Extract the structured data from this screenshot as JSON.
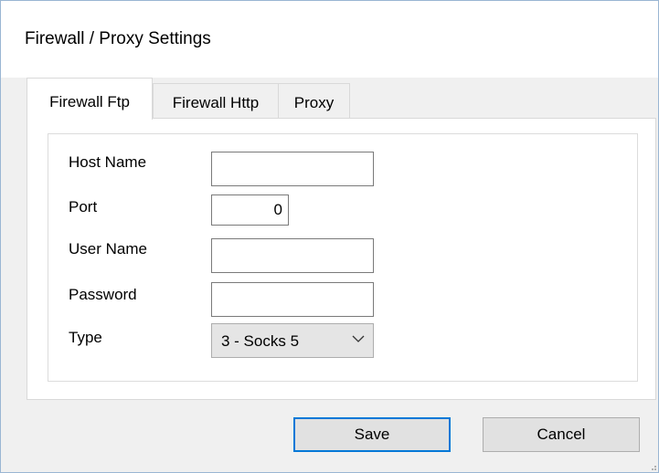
{
  "window": {
    "title": "Firewall / Proxy Settings"
  },
  "tabs": [
    {
      "label": "Firewall Ftp",
      "active": true
    },
    {
      "label": "Firewall Http",
      "active": false
    },
    {
      "label": "Proxy",
      "active": false
    }
  ],
  "form": {
    "host_name": {
      "label": "Host Name",
      "value": ""
    },
    "port": {
      "label": "Port",
      "value": "0"
    },
    "user_name": {
      "label": "User Name",
      "value": ""
    },
    "password": {
      "label": "Password",
      "value": ""
    },
    "type": {
      "label": "Type",
      "value": "3 - Socks 5"
    }
  },
  "buttons": {
    "save_label": "Save",
    "cancel_label": "Cancel"
  },
  "colors": {
    "accent": "#0078d7",
    "window_border": "#9ab6d3",
    "dialog_background": "#f0f0f0"
  }
}
